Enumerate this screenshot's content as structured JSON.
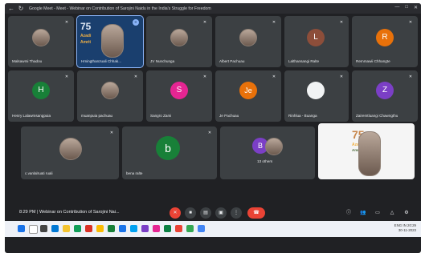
{
  "browser": {
    "title": "Google Meet - Meet - Webinar on Contribution of Sarojini Naidu in the India's Struggle for Freedom"
  },
  "participants": [
    {
      "name": "Malsawmi Thadou",
      "avatar_type": "photo"
    },
    {
      "name": "Hmingthanzuali Chhak...",
      "avatar_type": "photo",
      "speaking": true
    },
    {
      "name": "JV Nunchunga",
      "avatar_type": "photo"
    },
    {
      "name": "Albert Pachuau",
      "avatar_type": "photo"
    },
    {
      "name": "Lalthansangi Ralte",
      "initial": "L",
      "color": "#8d4e3a"
    },
    {
      "name": "Remmawii Chhangte",
      "initial": "R",
      "color": "#e8710a"
    },
    {
      "name": "Henry Lalawmsangpuia",
      "initial": "H",
      "color": "#188038"
    },
    {
      "name": "muanpuia pachuau",
      "avatar_type": "photo"
    },
    {
      "name": "Sangro Zami",
      "initial": "S",
      "color": "#e52592"
    },
    {
      "name": "Je Pachuau",
      "initial": "Je",
      "color": "#e8710a"
    },
    {
      "name": "Rinhlua - Buanga",
      "avatar_type": "photo"
    },
    {
      "name": "Zairemtluangi Chawngthu",
      "initial": "Z",
      "color": "#7b3fc6"
    },
    {
      "name": "c.vanlalruati ruali",
      "avatar_type": "photo"
    },
    {
      "name": "bena ralte",
      "initial": "b",
      "color": "#188038"
    },
    {
      "name": "13 others",
      "initial": "B",
      "color": "#7b3fc6"
    }
  ],
  "banner": {
    "line1": "75",
    "line2": "Azadi Ka",
    "line3": "Amrit Mahotsav"
  },
  "meeting": {
    "time": "8:29 PM",
    "separator": "|",
    "title": "Webinar on Contribution of Sarojini Nai..."
  },
  "controls": {
    "mic_icon": "mic-off-icon",
    "cam_icon": "camera-icon",
    "cc_icon": "captions-icon",
    "present_icon": "present-icon",
    "more_icon": "more-vert-icon",
    "end_icon": "call-end-icon"
  },
  "taskbar": {
    "tray_lang": "ENG IN",
    "clock_time": "20:29",
    "clock_date": "30-11-2023"
  }
}
